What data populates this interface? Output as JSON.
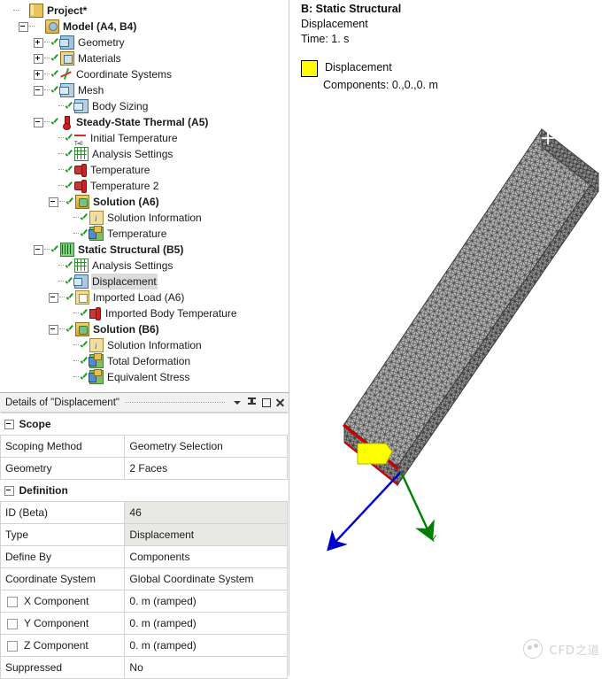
{
  "tree": {
    "nodes": [
      {
        "label": "Project*",
        "depth": 0,
        "icon": "project-icon",
        "expander": "none",
        "check": false,
        "bold": true,
        "selected": false
      },
      {
        "label": "Model (A4, B4)",
        "depth": 1,
        "icon": "model-icon",
        "expander": "minus",
        "check": false,
        "bold": true,
        "selected": false
      },
      {
        "label": "Geometry",
        "depth": 2,
        "icon": "geometry-icon",
        "expander": "plus",
        "check": true,
        "bold": false,
        "selected": false
      },
      {
        "label": "Materials",
        "depth": 2,
        "icon": "materials-icon",
        "expander": "plus",
        "check": true,
        "bold": false,
        "selected": false
      },
      {
        "label": "Coordinate Systems",
        "depth": 2,
        "icon": "coordinate-systems-icon",
        "expander": "plus",
        "check": true,
        "bold": false,
        "selected": false
      },
      {
        "label": "Mesh",
        "depth": 2,
        "icon": "mesh-icon",
        "expander": "minus",
        "check": true,
        "bold": false,
        "selected": false
      },
      {
        "label": "Body Sizing",
        "depth": 3,
        "icon": "body-sizing-icon",
        "expander": "none",
        "check": true,
        "bold": false,
        "selected": false
      },
      {
        "label": "Steady-State Thermal (A5)",
        "depth": 2,
        "icon": "thermal-icon",
        "expander": "minus",
        "check": true,
        "bold": true,
        "selected": false
      },
      {
        "label": "Initial Temperature",
        "depth": 3,
        "icon": "initial-temperature-icon",
        "expander": "none",
        "check": true,
        "bold": false,
        "selected": false
      },
      {
        "label": "Analysis Settings",
        "depth": 3,
        "icon": "analysis-settings-icon",
        "expander": "none",
        "check": true,
        "bold": false,
        "selected": false
      },
      {
        "label": "Temperature",
        "depth": 3,
        "icon": "temperature-load-icon",
        "expander": "none",
        "check": true,
        "bold": false,
        "selected": false
      },
      {
        "label": "Temperature 2",
        "depth": 3,
        "icon": "temperature-load-icon",
        "expander": "none",
        "check": true,
        "bold": false,
        "selected": false
      },
      {
        "label": "Solution (A6)",
        "depth": 3,
        "icon": "solution-icon",
        "expander": "minus",
        "check": true,
        "bold": true,
        "selected": false
      },
      {
        "label": "Solution Information",
        "depth": 4,
        "icon": "solution-information-icon",
        "expander": "none",
        "check": true,
        "bold": false,
        "selected": false
      },
      {
        "label": "Temperature",
        "depth": 4,
        "icon": "result-icon",
        "expander": "none",
        "check": true,
        "bold": false,
        "selected": false
      },
      {
        "label": "Static Structural (B5)",
        "depth": 2,
        "icon": "static-structural-icon",
        "expander": "minus",
        "check": true,
        "bold": true,
        "selected": false
      },
      {
        "label": "Analysis Settings",
        "depth": 3,
        "icon": "analysis-settings-icon",
        "expander": "none",
        "check": true,
        "bold": false,
        "selected": false
      },
      {
        "label": "Displacement",
        "depth": 3,
        "icon": "displacement-icon",
        "expander": "none",
        "check": true,
        "bold": false,
        "selected": true
      },
      {
        "label": "Imported Load (A6)",
        "depth": 3,
        "icon": "imported-load-icon",
        "expander": "minus",
        "check": true,
        "bold": false,
        "selected": false
      },
      {
        "label": "Imported Body Temperature",
        "depth": 4,
        "icon": "imported-body-temperature-icon",
        "expander": "none",
        "check": true,
        "bold": false,
        "selected": false
      },
      {
        "label": "Solution (B6)",
        "depth": 3,
        "icon": "solution-icon",
        "expander": "minus",
        "check": true,
        "bold": true,
        "selected": false
      },
      {
        "label": "Solution Information",
        "depth": 4,
        "icon": "solution-information-icon",
        "expander": "none",
        "check": true,
        "bold": false,
        "selected": false
      },
      {
        "label": "Total Deformation",
        "depth": 4,
        "icon": "result-icon",
        "expander": "none",
        "check": true,
        "bold": false,
        "selected": false
      },
      {
        "label": "Equivalent Stress",
        "depth": 4,
        "icon": "result-icon",
        "expander": "none",
        "check": true,
        "bold": false,
        "selected": false
      }
    ]
  },
  "details": {
    "title": "Details of \"Displacement\"",
    "title_buttons": [
      "caret-down-icon",
      "pin-icon",
      "maximize-icon",
      "close-icon"
    ],
    "rows": [
      {
        "kind": "section",
        "label": "Scope",
        "expander": "minus"
      },
      {
        "kind": "row",
        "label": "Scoping Method",
        "value": "Geometry Selection",
        "readonly": false,
        "checkbox": false
      },
      {
        "kind": "row",
        "label": "Geometry",
        "value": "2 Faces",
        "readonly": false,
        "checkbox": false
      },
      {
        "kind": "section",
        "label": "Definition",
        "expander": "minus"
      },
      {
        "kind": "row",
        "label": "ID (Beta)",
        "value": "46",
        "readonly": true,
        "checkbox": false
      },
      {
        "kind": "row",
        "label": "Type",
        "value": "Displacement",
        "readonly": true,
        "checkbox": false
      },
      {
        "kind": "row",
        "label": "Define By",
        "value": "Components",
        "readonly": false,
        "checkbox": false
      },
      {
        "kind": "row",
        "label": "Coordinate System",
        "value": "Global Coordinate System",
        "readonly": false,
        "checkbox": false
      },
      {
        "kind": "row",
        "label": "X Component",
        "value": "0. m  (ramped)",
        "readonly": false,
        "checkbox": true
      },
      {
        "kind": "row",
        "label": "Y Component",
        "value": "0. m  (ramped)",
        "readonly": false,
        "checkbox": true
      },
      {
        "kind": "row",
        "label": "Z Component",
        "value": "0. m  (ramped)",
        "readonly": false,
        "checkbox": true
      },
      {
        "kind": "row",
        "label": "Suppressed",
        "value": "No",
        "readonly": false,
        "checkbox": false
      }
    ]
  },
  "viewport": {
    "title": "B: Static Structural",
    "subtitle": "Displacement",
    "time": "Time: 1. s",
    "legend_label": "Displacement",
    "legend_components": "Components: 0.,0.,0. m",
    "legend_color": "#ffff00",
    "axis_x_color": "#cc0000",
    "axis_y_color": "#008000",
    "axis_z_color": "#0000cc",
    "mesh_fill": "#b4b4b4",
    "mesh_line": "#4a4a4a",
    "watermark": "CFD之道"
  }
}
